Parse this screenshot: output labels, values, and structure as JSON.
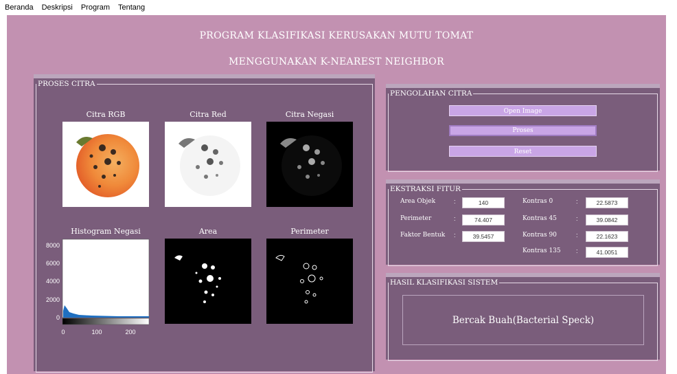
{
  "menu": [
    "Beranda",
    "Deskripsi",
    "Program",
    "Tentang"
  ],
  "title": {
    "line1": "PROGRAM KLASIFIKASI KERUSAKAN MUTU TOMAT",
    "line2": "MENGGUNAKAN K-NEAREST NEIGHBOR"
  },
  "proses_citra": {
    "label": "PROSES CITRA",
    "captions": [
      "Citra RGB",
      "Citra Red",
      "Citra Negasi",
      "Histogram Negasi",
      "Area",
      "Perimeter"
    ],
    "histogram": {
      "y_ticks": [
        "8000",
        "6000",
        "4000",
        "2000",
        "0"
      ],
      "x_ticks": [
        "0",
        "100",
        "200"
      ]
    }
  },
  "pengolahan_citra": {
    "label": "PENGOLAHAN CITRA",
    "buttons": [
      "Open Image",
      "Proses",
      "Reset"
    ]
  },
  "ekstraksi_fitur": {
    "label": "EKSTRAKSI FITUR",
    "left": [
      {
        "label": "Area Objek",
        "value": "140"
      },
      {
        "label": "Perimeter",
        "value": "74.407"
      },
      {
        "label": "Faktor Bentuk",
        "value": "39.5457"
      }
    ],
    "right": [
      {
        "label": "Kontras 0",
        "value": "22.5873"
      },
      {
        "label": "Kontras 45",
        "value": "39.0842"
      },
      {
        "label": "Kontras 90",
        "value": "22.1623"
      },
      {
        "label": "Kontras 135",
        "value": "41.0051"
      }
    ]
  },
  "hasil": {
    "label": "HASIL KLASIFIKASI SISTEM",
    "result": "Bercak Buah(Bacterial Speck)"
  },
  "colors": {
    "background": "#c291b1",
    "panel": "#7a5d7b",
    "button": "#c9a5e6"
  }
}
